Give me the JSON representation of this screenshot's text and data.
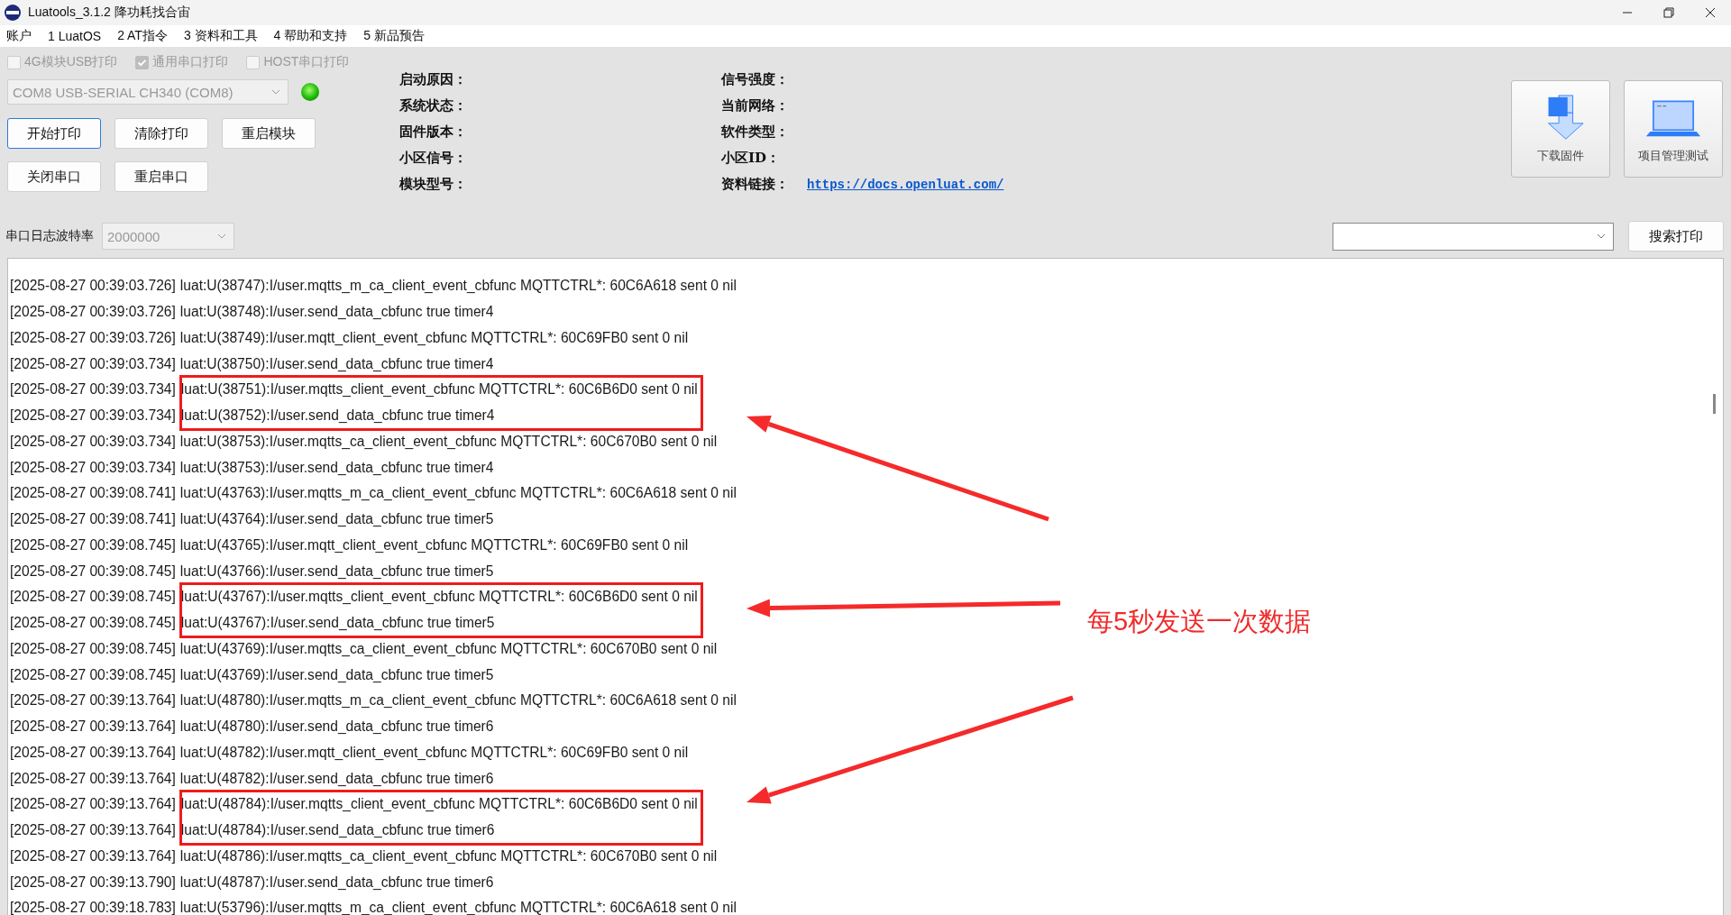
{
  "window": {
    "title": "Luatools_3.1.2 降功耗找合宙"
  },
  "menu": [
    "账户",
    "1 LuatOS",
    "2 AT指令",
    "3 资料和工具",
    "4 帮助和支持",
    "5 新品预告"
  ],
  "print_options": [
    {
      "label": "4G模块USB打印",
      "checked": false,
      "disabled": true
    },
    {
      "label": "通用串口打印",
      "checked": true,
      "disabled": true
    },
    {
      "label": "HOST串口打印",
      "checked": false,
      "disabled": true
    }
  ],
  "port": {
    "value": "COM8 USB-SERIAL CH340 (COM8)",
    "disabled": true
  },
  "status_led": {
    "on": true
  },
  "buttons": [
    [
      {
        "label": "开始打印",
        "focused": true
      },
      {
        "label": "清除打印",
        "focused": false
      },
      {
        "label": "重启模块",
        "focused": false
      }
    ],
    [
      {
        "label": "关闭串口",
        "focused": false
      },
      {
        "label": "重启串口",
        "focused": false
      }
    ]
  ],
  "info": {
    "left": [
      {
        "label": "启动原因："
      },
      {
        "label": "系统状态："
      },
      {
        "label": "固件版本："
      },
      {
        "label": "小区信号："
      },
      {
        "label": "模块型号："
      }
    ],
    "right": [
      {
        "label": "信号强度："
      },
      {
        "label": "当前网络："
      },
      {
        "label": "软件类型："
      },
      {
        "label": "小区ID："
      },
      {
        "label": "资料链接：",
        "link": "https://docs.openluat.com/"
      }
    ]
  },
  "tools": [
    {
      "label": "下载固件",
      "kind": "download"
    },
    {
      "label": "项目管理测试",
      "kind": "laptop"
    }
  ],
  "baud": {
    "label": "串口日志波特率",
    "value": "2000000"
  },
  "search": {
    "button": "搜索打印"
  },
  "log": {
    "rows": [
      {
        "kind": "line",
        "time": "[2025-08-27 00:39:03.726]",
        "message": "luat:U(38747):I/user.mqtts_m_ca_client_event_cbfunc MQTTCTRL*: 60C6A618 sent 0 nil"
      },
      {
        "kind": "line",
        "time": "[2025-08-27 00:39:03.726]",
        "message": "luat:U(38748):I/user.send_data_cbfunc true timer4"
      },
      {
        "kind": "line",
        "time": "[2025-08-27 00:39:03.726]",
        "message": "luat:U(38749):I/user.mqtt_client_event_cbfunc MQTTCTRL*: 60C69FB0 sent 0 nil"
      },
      {
        "kind": "line",
        "time": "[2025-08-27 00:39:03.734]",
        "message": "luat:U(38750):I/user.send_data_cbfunc true timer4"
      },
      {
        "kind": "highlight",
        "rows": [
          {
            "time": "[2025-08-27 00:39:03.734]",
            "message": "luat:U(38751):I/user.mqtts_client_event_cbfunc MQTTCTRL*: 60C6B6D0 sent 0 nil"
          },
          {
            "time": "[2025-08-27 00:39:03.734]",
            "message": "luat:U(38752):I/user.send_data_cbfunc true timer4"
          }
        ]
      },
      {
        "kind": "line",
        "time": "[2025-08-27 00:39:03.734]",
        "message": "luat:U(38753):I/user.mqtts_ca_client_event_cbfunc MQTTCTRL*: 60C670B0 sent 0 nil"
      },
      {
        "kind": "line",
        "time": "[2025-08-27 00:39:03.734]",
        "message": "luat:U(38753):I/user.send_data_cbfunc true timer4"
      },
      {
        "kind": "line",
        "time": "[2025-08-27 00:39:08.741]",
        "message": "luat:U(43763):I/user.mqtts_m_ca_client_event_cbfunc MQTTCTRL*: 60C6A618 sent 0 nil"
      },
      {
        "kind": "line",
        "time": "[2025-08-27 00:39:08.741]",
        "message": "luat:U(43764):I/user.send_data_cbfunc true timer5"
      },
      {
        "kind": "line",
        "time": "[2025-08-27 00:39:08.745]",
        "message": "luat:U(43765):I/user.mqtt_client_event_cbfunc MQTTCTRL*: 60C69FB0 sent 0 nil"
      },
      {
        "kind": "line",
        "time": "[2025-08-27 00:39:08.745]",
        "message": "luat:U(43766):I/user.send_data_cbfunc true timer5"
      },
      {
        "kind": "highlight",
        "rows": [
          {
            "time": "[2025-08-27 00:39:08.745]",
            "message": "luat:U(43767):I/user.mqtts_client_event_cbfunc MQTTCTRL*: 60C6B6D0 sent 0 nil"
          },
          {
            "time": "[2025-08-27 00:39:08.745]",
            "message": "luat:U(43767):I/user.send_data_cbfunc true timer5"
          }
        ]
      },
      {
        "kind": "line",
        "time": "[2025-08-27 00:39:08.745]",
        "message": "luat:U(43769):I/user.mqtts_ca_client_event_cbfunc MQTTCTRL*: 60C670B0 sent 0 nil"
      },
      {
        "kind": "line",
        "time": "[2025-08-27 00:39:08.745]",
        "message": "luat:U(43769):I/user.send_data_cbfunc true timer5"
      },
      {
        "kind": "line",
        "time": "[2025-08-27 00:39:13.764]",
        "message": "luat:U(48780):I/user.mqtts_m_ca_client_event_cbfunc MQTTCTRL*: 60C6A618 sent 0 nil"
      },
      {
        "kind": "line",
        "time": "[2025-08-27 00:39:13.764]",
        "message": "luat:U(48780):I/user.send_data_cbfunc true timer6"
      },
      {
        "kind": "line",
        "time": "[2025-08-27 00:39:13.764]",
        "message": "luat:U(48782):I/user.mqtt_client_event_cbfunc MQTTCTRL*: 60C69FB0 sent 0 nil"
      },
      {
        "kind": "line",
        "time": "[2025-08-27 00:39:13.764]",
        "message": "luat:U(48782):I/user.send_data_cbfunc true timer6"
      },
      {
        "kind": "highlight",
        "rows": [
          {
            "time": "[2025-08-27 00:39:13.764]",
            "message": "luat:U(48784):I/user.mqtts_client_event_cbfunc MQTTCTRL*: 60C6B6D0 sent 0 nil"
          },
          {
            "time": "[2025-08-27 00:39:13.764]",
            "message": "luat:U(48784):I/user.send_data_cbfunc true timer6"
          }
        ]
      },
      {
        "kind": "line",
        "time": "[2025-08-27 00:39:13.764]",
        "message": "luat:U(48786):I/user.mqtts_ca_client_event_cbfunc MQTTCTRL*: 60C670B0 sent 0 nil"
      },
      {
        "kind": "line",
        "time": "[2025-08-27 00:39:13.790]",
        "message": "luat:U(48787):I/user.send_data_cbfunc true timer6"
      },
      {
        "kind": "line",
        "time": "[2025-08-27 00:39:18.783]",
        "message": "luat:U(53796):I/user.mqtts_m_ca_client_event_cbfunc MQTTCTRL*: 60C6A618 sent 0 nil"
      }
    ]
  },
  "annotation": {
    "text": "每5秒发送一次数据"
  }
}
